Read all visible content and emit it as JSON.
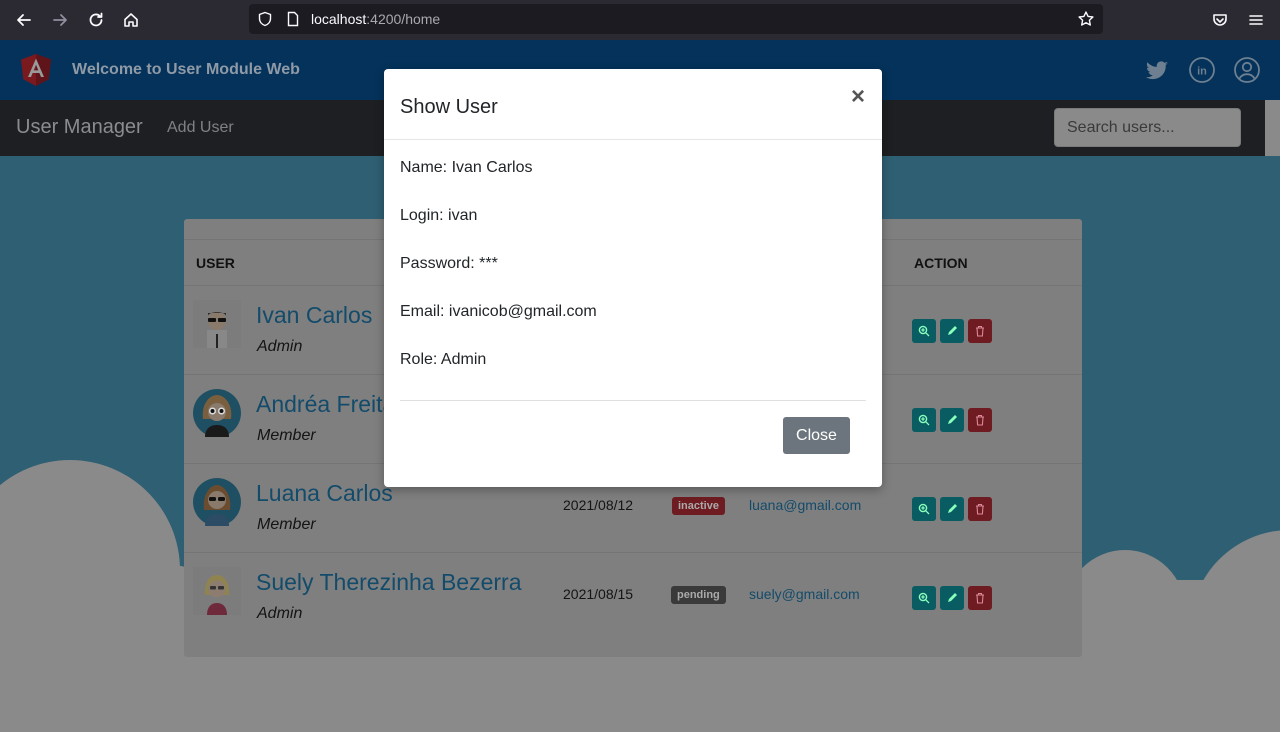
{
  "browser": {
    "url_host": "localhost",
    "url_path": ":4200/home"
  },
  "app": {
    "title": "Welcome to User Module Web",
    "brand": "User Manager",
    "nav_add": "Add User",
    "search_placeholder": "Search users..."
  },
  "table": {
    "headers": {
      "user": "USER",
      "action": "ACTION"
    },
    "rows": [
      {
        "name": "Ivan Carlos",
        "role": "Admin",
        "date": "",
        "status": "",
        "email": ""
      },
      {
        "name": "Andréa Freita",
        "role": "Member",
        "date": "",
        "status": "",
        "email": ""
      },
      {
        "name": "Luana Carlos",
        "role": "Member",
        "date": "2021/08/12",
        "status": "inactive",
        "email": "luana@gmail.com"
      },
      {
        "name": "Suely Therezinha Bezerra",
        "role": "Admin",
        "date": "2021/08/15",
        "status": "pending",
        "email": "suely@gmail.com"
      }
    ]
  },
  "modal": {
    "title": "Show User",
    "close_symbol": "×",
    "name": "Name: Ivan Carlos",
    "login": "Login: ivan",
    "password": "Password: ***",
    "email": "Email: ivanicob@gmail.com",
    "role": "Role: Admin",
    "close_label": "Close"
  },
  "colors": {
    "header_bg": "#04325a",
    "navbar_bg": "#1d1f22",
    "link": "#134b6b",
    "badge_inactive": "#6e1c21",
    "badge_pending": "#3a3a3a",
    "btn_view": "#0a5c63",
    "btn_edit": "#0a5c63",
    "btn_delete": "#6e1c21",
    "modal_close_btn": "#6c757d"
  }
}
